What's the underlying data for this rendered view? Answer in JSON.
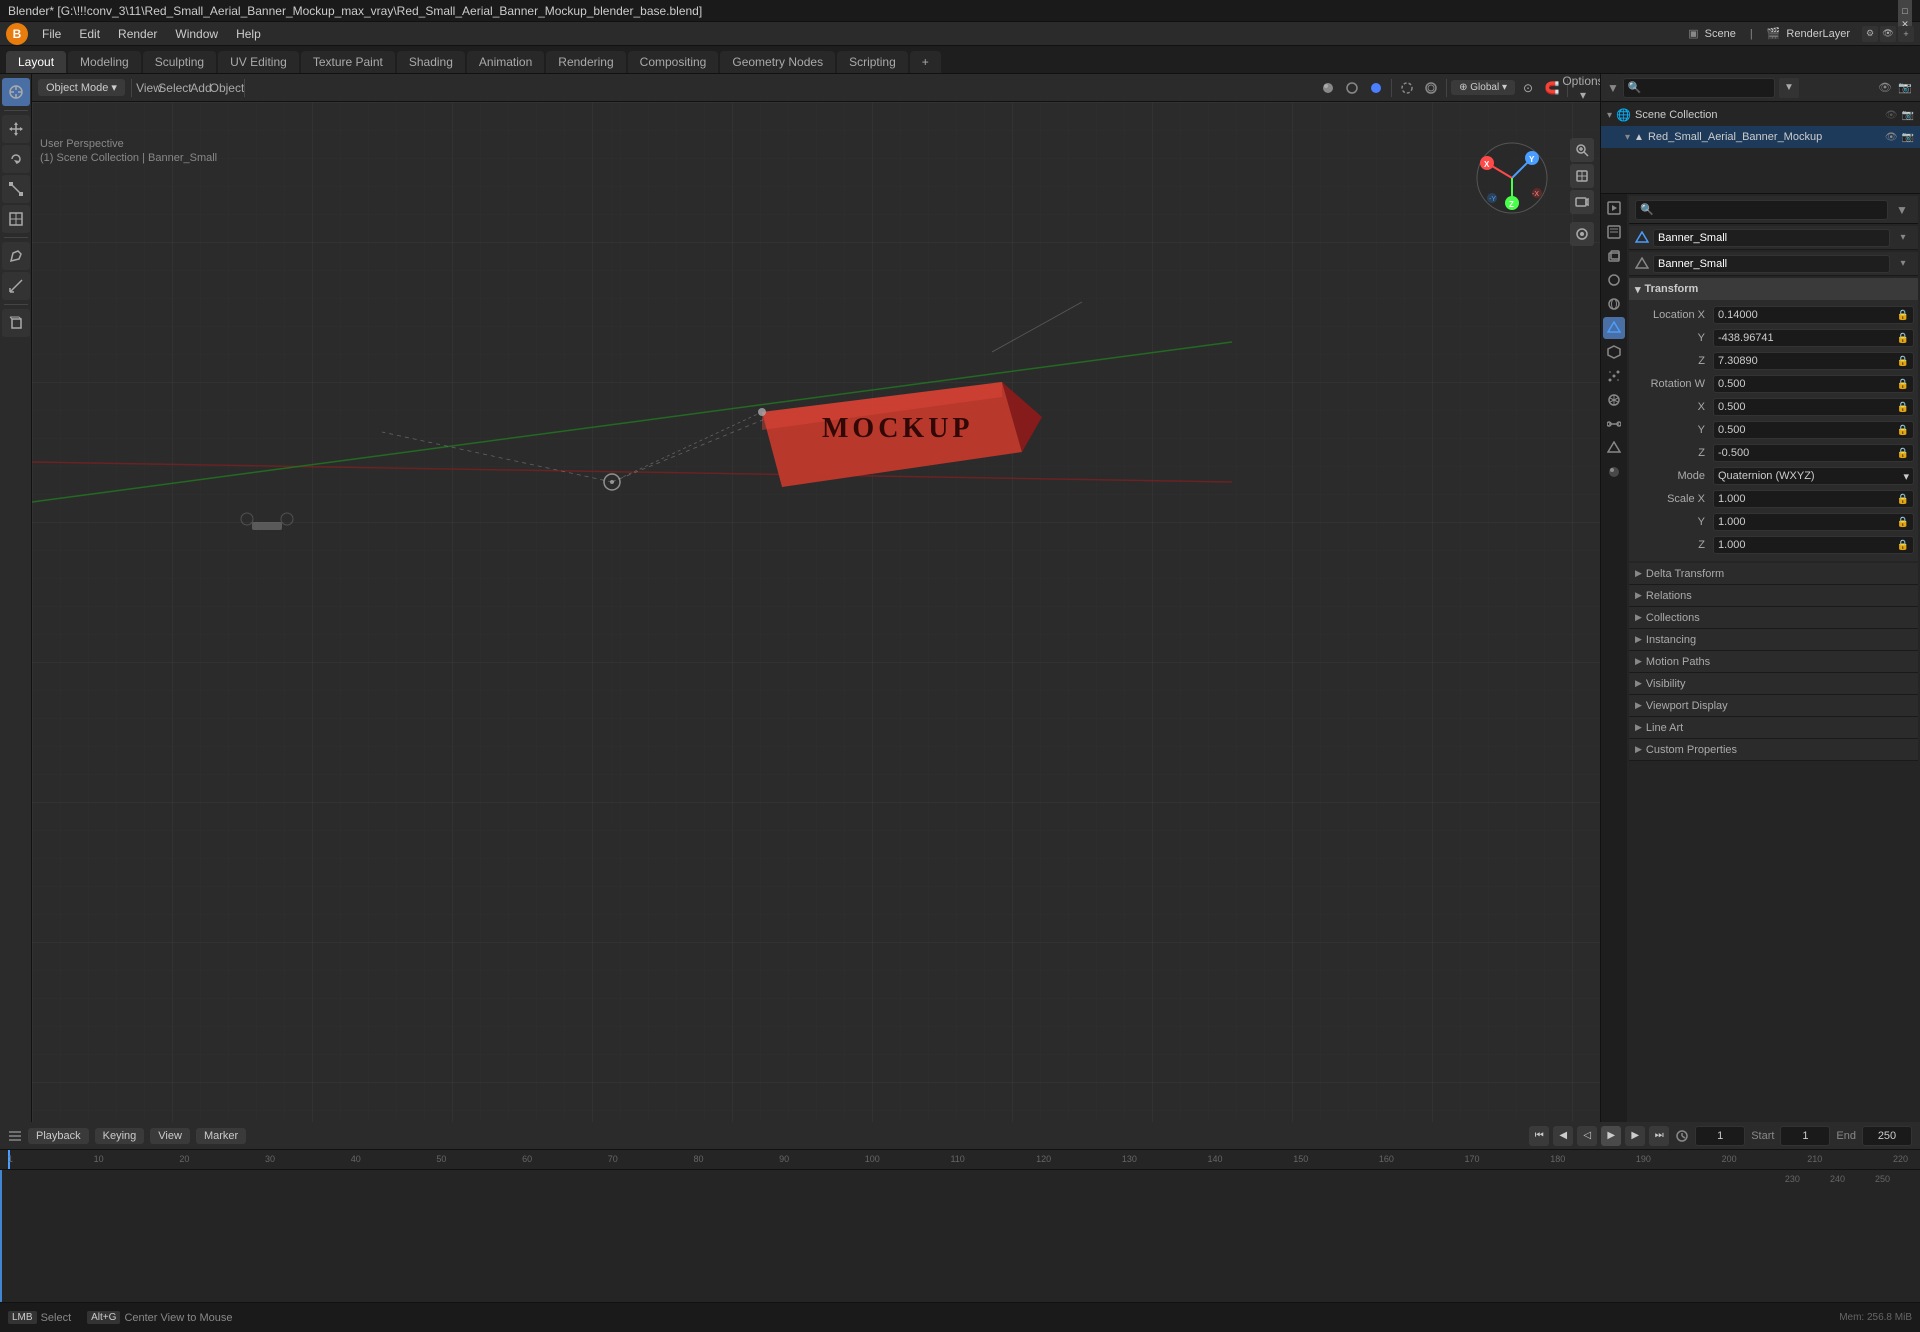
{
  "titleBar": {
    "text": "Blender* [G:\\!!!conv_3\\11\\Red_Small_Aerial_Banner_Mockup_max_vray\\Red_Small_Aerial_Banner_Mockup_blender_base.blend]",
    "minimize": "─",
    "maximize": "□",
    "close": "✕"
  },
  "menuBar": {
    "items": [
      "Blender",
      "File",
      "Edit",
      "Render",
      "Window",
      "Help"
    ]
  },
  "workspaceTabs": {
    "items": [
      "Layout",
      "Modeling",
      "Sculpting",
      "UV Editing",
      "Texture Paint",
      "Shading",
      "Animation",
      "Rendering",
      "Compositing",
      "Geometry Nodes",
      "Scripting"
    ],
    "active": "Layout",
    "plus": "+"
  },
  "viewport": {
    "modeLabel": "Object Mode",
    "viewLabel": "View",
    "selectLabel": "Select",
    "addLabel": "Add",
    "objectLabel": "Object",
    "perspInfo": "User Perspective",
    "collectionInfo": "(1) Scene Collection | Banner_Small",
    "transformOrigin": "Global",
    "optionsLabel": "Options"
  },
  "outliner": {
    "sceneCollection": "Scene Collection",
    "items": [
      {
        "name": "Red_Small_Aerial_Banner_Mockup",
        "active": true
      }
    ]
  },
  "properties": {
    "objectName": "Banner_Small",
    "dataName": "Banner_Small",
    "transform": {
      "label": "Transform",
      "locationX": "0.14000",
      "locationY": "-438.96741",
      "locationZ": "7.30890",
      "rotationW": "0.500",
      "rotationX": "0.500",
      "rotationY": "0.500",
      "rotationZ": "-0.500",
      "mode": "Quaternion (WXYZ)",
      "scaleX": "1.000",
      "scaleY": "1.000",
      "scaleZ": "1.000"
    },
    "sections": [
      {
        "label": "Delta Transform",
        "collapsed": true
      },
      {
        "label": "Relations",
        "collapsed": true
      },
      {
        "label": "Collections",
        "collapsed": true
      },
      {
        "label": "Instancing",
        "collapsed": true
      },
      {
        "label": "Motion Paths",
        "collapsed": true
      },
      {
        "label": "Visibility",
        "collapsed": true
      },
      {
        "label": "Viewport Display",
        "collapsed": true
      },
      {
        "label": "Line Art",
        "collapsed": true
      },
      {
        "label": "Custom Properties",
        "collapsed": true
      }
    ]
  },
  "timeline": {
    "playbackLabel": "Playback",
    "keyingLabel": "Keying",
    "viewLabel": "View",
    "markerLabel": "Marker",
    "currentFrame": "1",
    "startFrame": "1",
    "startLabel": "Start",
    "endFrame": "250",
    "endLabel": "End",
    "frameMarks": [
      "1",
      "10",
      "20",
      "30",
      "40",
      "50",
      "60",
      "70",
      "80",
      "90",
      "100",
      "110",
      "120",
      "130",
      "140",
      "150",
      "160",
      "170",
      "180",
      "190",
      "200",
      "210",
      "220",
      "230",
      "240",
      "250"
    ]
  },
  "statusBar": {
    "leftKey": "Select",
    "leftDesc": "Select",
    "midKey": "...",
    "midDesc": "Center View to Mouse",
    "rightDesc": ""
  },
  "icons": {
    "cursor": "⊕",
    "move": "✛",
    "rotate": "↻",
    "scale": "⤡",
    "transform": "⊞",
    "annotate": "✏",
    "measure": "📏",
    "eyedropper": "💧",
    "camera": "📷",
    "render": "🎨",
    "material": "●",
    "object": "▲",
    "scene": "🌐",
    "world": "○",
    "constraint": "🔗",
    "modifier": "🔧",
    "particles": "✦",
    "physics": "⚡",
    "search": "🔍",
    "filter": "▼",
    "lock": "🔒",
    "eye": "👁",
    "mesh": "▲",
    "camera2": "📷"
  }
}
